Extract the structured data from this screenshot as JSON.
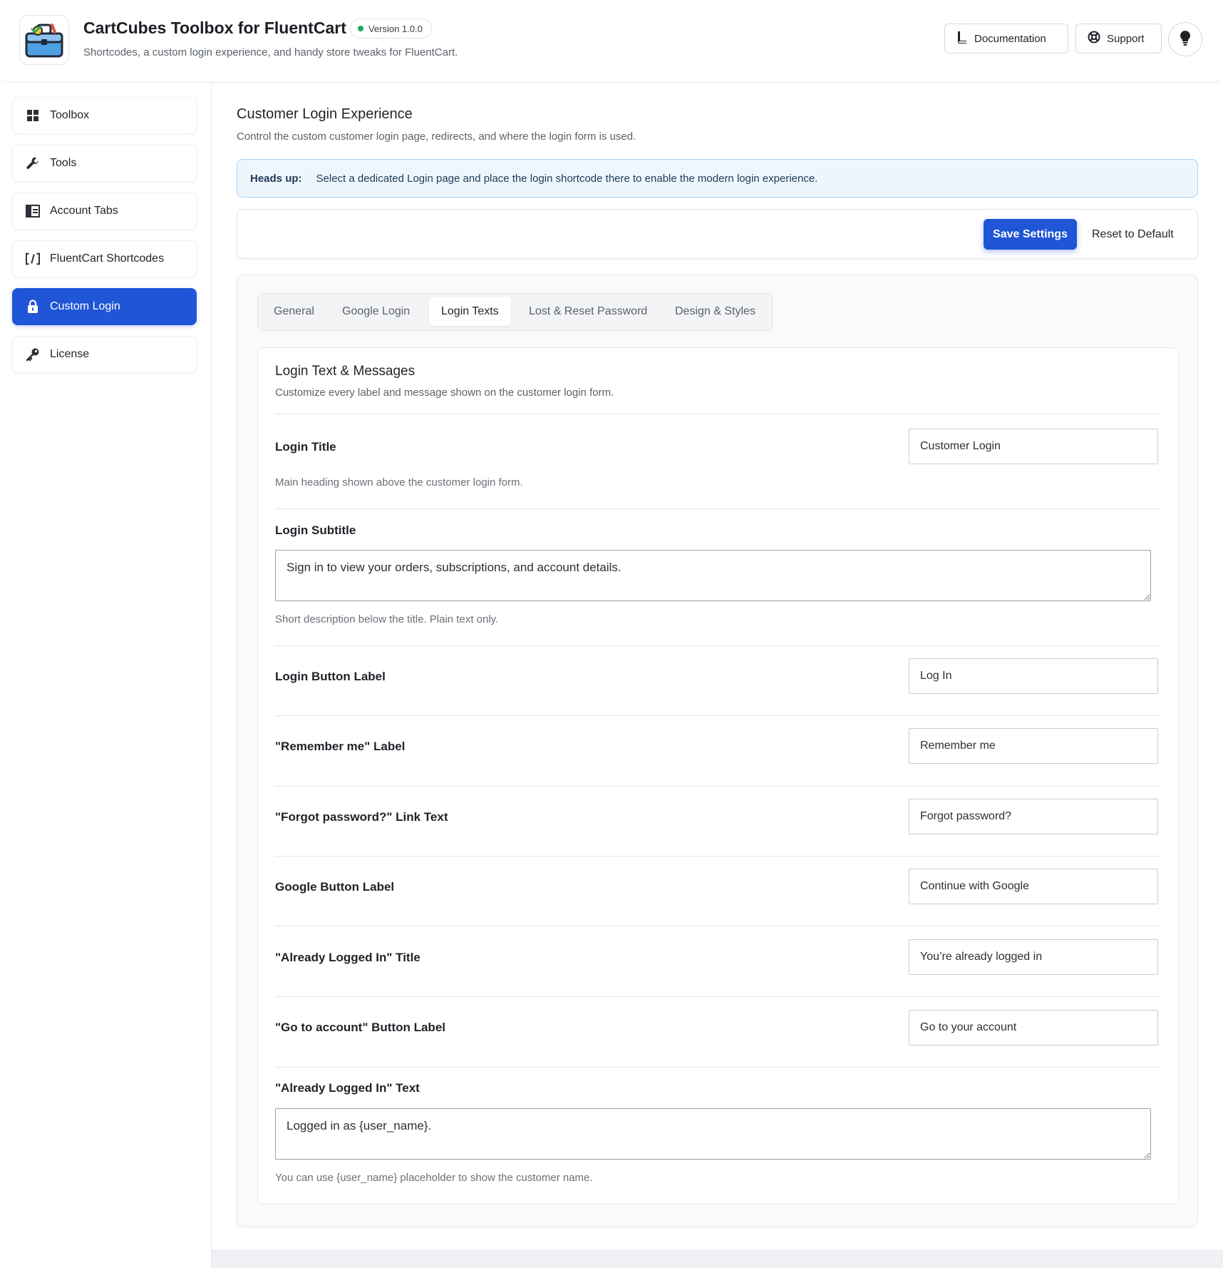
{
  "header": {
    "app_title": "CartCubes Toolbox for FluentCart",
    "version": "Version 1.0.0",
    "subtitle": "Shortcodes, a custom login experience, and handy store tweaks for FluentCart.",
    "documentation_label": "Documentation",
    "support_label": "Support",
    "icons": {
      "logo": "toolbox-icon",
      "documentation": "book-icon",
      "support": "lifebuoy-icon",
      "tips": "lightbulb-icon"
    }
  },
  "sidebar": {
    "items": [
      {
        "label": "Toolbox",
        "icon": "grid-icon",
        "active": false
      },
      {
        "label": "Tools",
        "icon": "wrench-icon",
        "active": false
      },
      {
        "label": "Account Tabs",
        "icon": "tabs-icon",
        "active": false
      },
      {
        "label": "FluentCart Shortcodes",
        "icon": "shortcode-icon",
        "active": false
      },
      {
        "label": "Custom Login",
        "icon": "lock-icon",
        "active": true
      },
      {
        "label": "License",
        "icon": "key-icon",
        "active": false
      }
    ]
  },
  "main": {
    "title": "Customer Login Experience",
    "description": "Control the custom customer login page, redirects, and where the login form is used.",
    "notice": {
      "label": "Heads up:",
      "text": "Select a dedicated Login page and place the login shortcode there to enable the modern login experience."
    },
    "save_label": "Save Settings",
    "reset_label": "Reset to Default",
    "tabs": [
      {
        "label": "General",
        "active": false
      },
      {
        "label": "Google Login",
        "active": false
      },
      {
        "label": "Login Texts",
        "active": true
      },
      {
        "label": "Lost & Reset Password",
        "active": false
      },
      {
        "label": "Design & Styles",
        "active": false
      }
    ],
    "card": {
      "title": "Login Text & Messages",
      "description": "Customize every label and message shown on the customer login form.",
      "fields": {
        "login_title": {
          "label": "Login Title",
          "value": "Customer Login",
          "help": "Main heading shown above the customer login form."
        },
        "login_subtitle": {
          "label": "Login Subtitle",
          "value": "Sign in to view your orders, subscriptions, and account details.",
          "help": "Short description below the title. Plain text only."
        },
        "login_button": {
          "label": "Login Button Label",
          "value": "Log In"
        },
        "remember_me": {
          "label": "\"Remember me\" Label",
          "value": "Remember me"
        },
        "forgot_password": {
          "label": "\"Forgot password?\" Link Text",
          "value": "Forgot password?"
        },
        "google_button": {
          "label": "Google Button Label",
          "value": "Continue with Google"
        },
        "already_title": {
          "label": "\"Already Logged In\" Title",
          "value": "You’re already logged in"
        },
        "go_account": {
          "label": "\"Go to account\" Button Label",
          "value": "Go to your account"
        },
        "already_text": {
          "label": "\"Already Logged In\" Text",
          "value": "Logged in as {user_name}.",
          "help": "You can use {user_name} placeholder to show the customer name."
        }
      }
    }
  },
  "colors": {
    "accent": "#1f55d6",
    "notice_bg": "#eef6fd",
    "notice_border": "#a9d2f3",
    "status_dot": "#22a45d"
  }
}
